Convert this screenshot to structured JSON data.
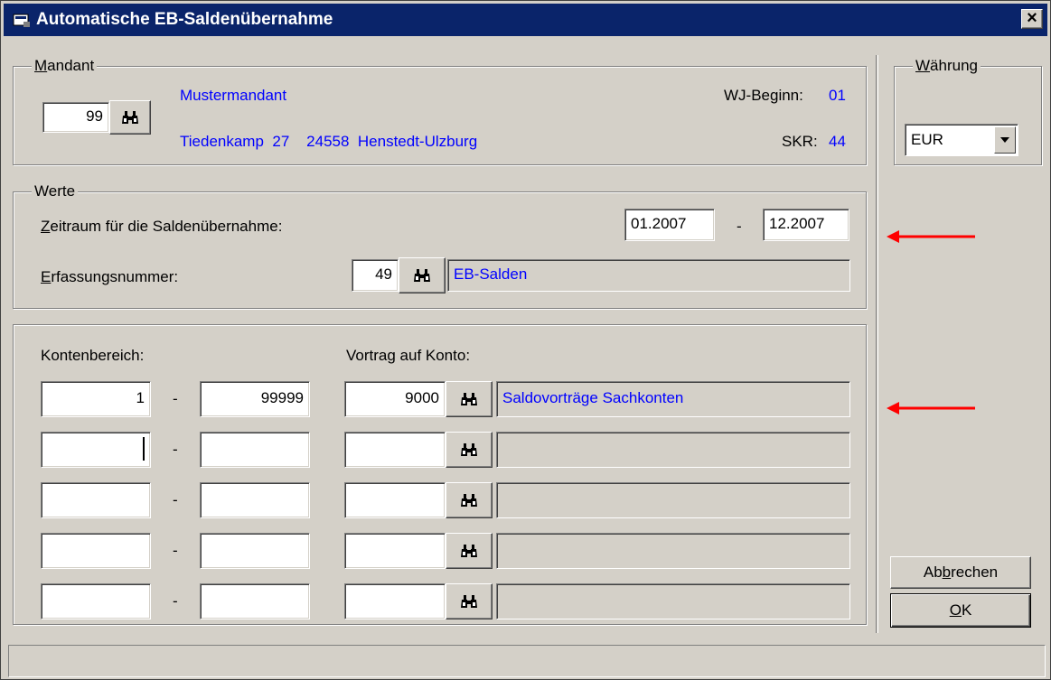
{
  "window": {
    "title": "Automatische EB-Saldenübernahme",
    "close_label": "×"
  },
  "mandant": {
    "legend": "Mandant",
    "number": "99",
    "name": "Mustermandant",
    "address": "Tiedenkamp  27    24558  Henstedt-Ulzburg",
    "wj_label": "WJ-Beginn:",
    "wj_value": "01",
    "skr_label": "SKR:",
    "skr_value": "44"
  },
  "waehrung": {
    "legend": "Währung",
    "selected": "EUR"
  },
  "werte": {
    "legend": "Werte",
    "zeitraum_label": "Zeitraum für die Saldenübernahme:",
    "from": "01.2007",
    "to": "12.2007",
    "separator": "-",
    "erfassung_label": "Erfassungsnummer:",
    "erfassung_number": "49",
    "erfassung_name": "EB-Salden"
  },
  "konten": {
    "range_label": "Kontenbereich:",
    "vortrag_label": "Vortrag auf Konto:",
    "separator": "-",
    "rows": [
      {
        "from": "1",
        "to": "99999",
        "konto": "9000",
        "name": "Saldovorträge Sachkonten"
      },
      {
        "from": "",
        "to": "",
        "konto": "",
        "name": ""
      },
      {
        "from": "",
        "to": "",
        "konto": "",
        "name": ""
      },
      {
        "from": "",
        "to": "",
        "konto": "",
        "name": ""
      },
      {
        "from": "",
        "to": "",
        "konto": "",
        "name": ""
      }
    ]
  },
  "buttons": {
    "cancel": "Abbrechen",
    "ok": "OK"
  },
  "colors": {
    "titlebar": "#0a246a",
    "face": "#d4d0c8",
    "accent_text": "#0000ff",
    "arrow": "#ff0000"
  }
}
